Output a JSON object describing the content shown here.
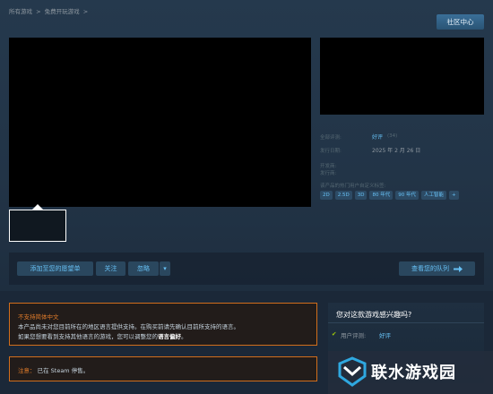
{
  "breadcrumb": [
    "所有游戏",
    ">",
    "免费开玩游戏",
    ">"
  ],
  "header": {
    "community_hub": "社区中心"
  },
  "details": {
    "reviews_label": "全部评测:",
    "reviews_value": "好评",
    "reviews_count": "(34)",
    "release_label": "发行日期:",
    "release_value": "2025 年 2 月 26 日",
    "developer_label": "开发商:",
    "publisher_label": "发行商:",
    "tags_label": "该产品的热门用户自定义标签:",
    "tags": [
      "2D",
      "2.5D",
      "3D",
      "80 年代",
      "90 年代",
      "人工智能",
      "+"
    ]
  },
  "actions": {
    "wishlist": "添加至您的愿望单",
    "follow": "关注",
    "ignore": "忽略",
    "dropdown": "▾",
    "queue": "查看您的队列",
    "queue_icon": "queue-arrow-icon"
  },
  "language_warning": {
    "title": "不支持简体中文",
    "line1": "本产品尚未对您目前所在的地区语言提供支持。在购买前请先确认目前所支持的语言。",
    "line2_pre": "如果您想要看到支持其他语言的游戏，您可以调整您的",
    "line2_bold": "语言偏好",
    "line2_post": "。"
  },
  "note": {
    "label": "注意：",
    "text": "已在 Steam 停售。"
  },
  "interest": {
    "title": "您对这款游戏感兴趣吗?",
    "check": "✔",
    "review_label": "用户评测:",
    "review_value": "好评"
  },
  "watermark": {
    "text": "联水游戏园"
  },
  "colors": {
    "accent": "#67c1f5",
    "warning": "#d16e1c",
    "bg": "#1b2838"
  }
}
